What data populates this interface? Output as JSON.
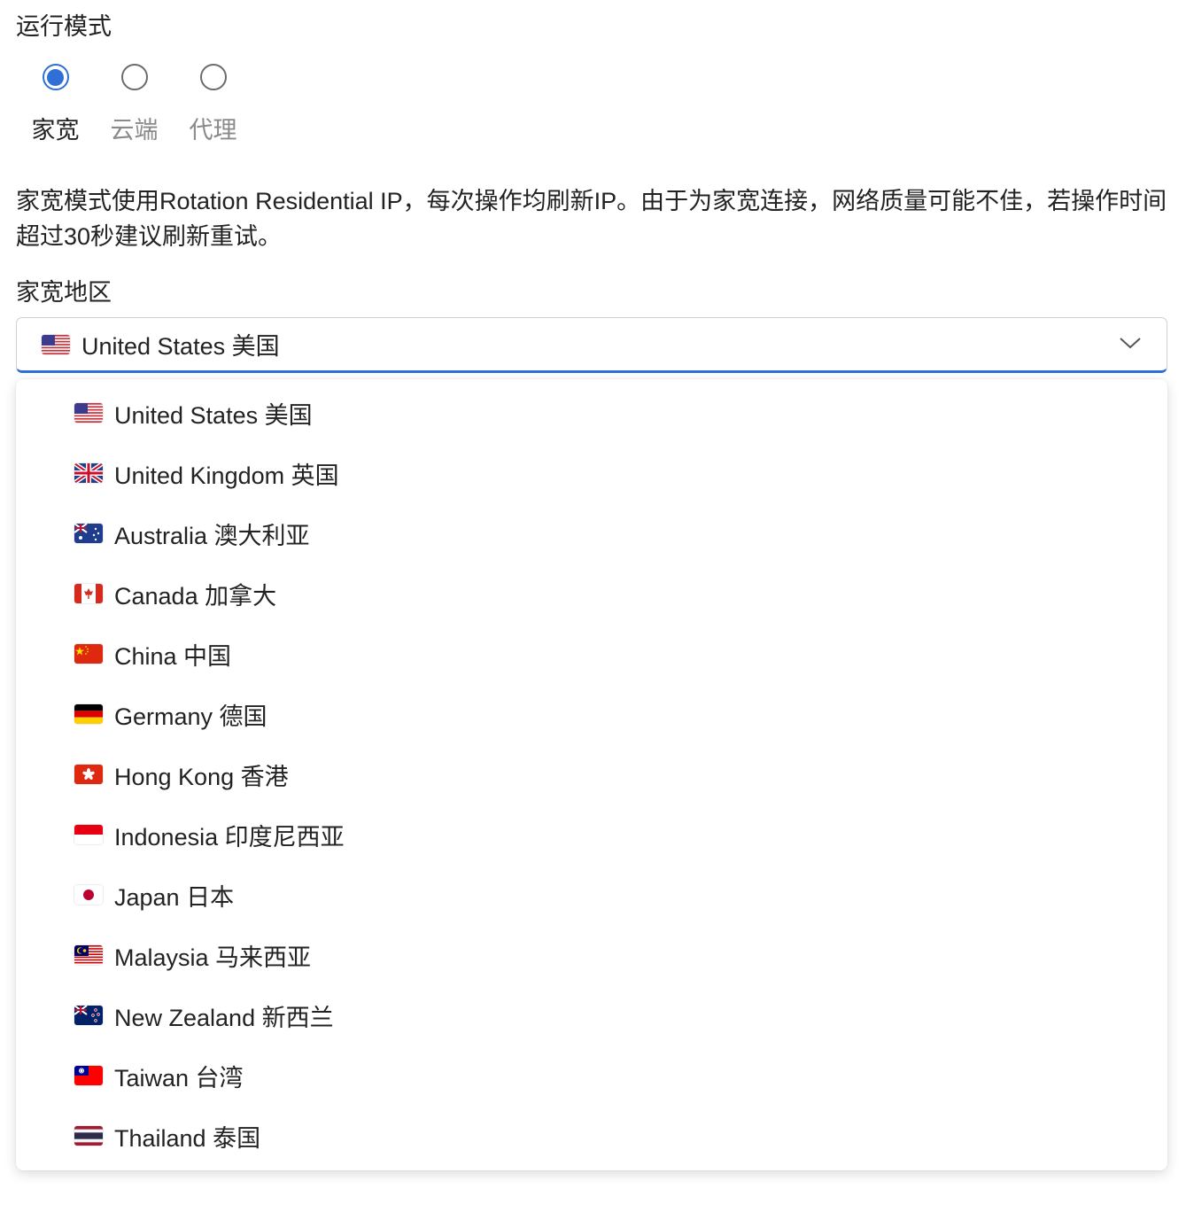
{
  "mode": {
    "label": "运行模式",
    "options": [
      {
        "label": "家宽",
        "selected": true
      },
      {
        "label": "云端",
        "selected": false
      },
      {
        "label": "代理",
        "selected": false
      }
    ]
  },
  "description": "家宽模式使用Rotation Residential IP，每次操作均刷新IP。由于为家宽连接，网络质量可能不佳，若操作时间超过30秒建议刷新重试。",
  "region": {
    "label": "家宽地区",
    "selected": "United States 美国",
    "selected_flag": "us-flag-icon",
    "options": [
      {
        "label": "United States 美国",
        "flag": "us-flag-icon"
      },
      {
        "label": "United Kingdom 英国",
        "flag": "uk-flag-icon"
      },
      {
        "label": "Australia 澳大利亚",
        "flag": "australia-flag-icon"
      },
      {
        "label": "Canada 加拿大",
        "flag": "canada-flag-icon"
      },
      {
        "label": "China 中国",
        "flag": "china-flag-icon"
      },
      {
        "label": "Germany 德国",
        "flag": "germany-flag-icon"
      },
      {
        "label": "Hong Kong 香港",
        "flag": "hong-kong-flag-icon"
      },
      {
        "label": "Indonesia 印度尼西亚",
        "flag": "indonesia-flag-icon"
      },
      {
        "label": "Japan 日本",
        "flag": "japan-flag-icon"
      },
      {
        "label": "Malaysia 马来西亚",
        "flag": "malaysia-flag-icon"
      },
      {
        "label": "New Zealand 新西兰",
        "flag": "new-zealand-flag-icon"
      },
      {
        "label": "Taiwan 台湾",
        "flag": "taiwan-flag-icon"
      },
      {
        "label": "Thailand 泰国",
        "flag": "thailand-flag-icon"
      }
    ]
  },
  "colors": {
    "accent": "#2f6fd6",
    "text": "#222222",
    "muted_text": "#8a8a8a"
  }
}
